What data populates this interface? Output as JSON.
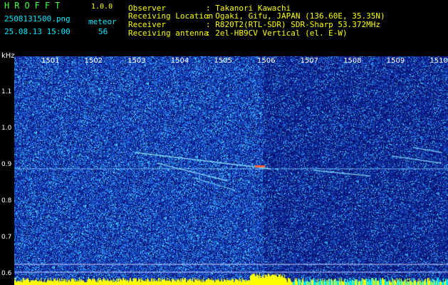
{
  "header": {
    "app_title": "HROFFT",
    "app_version": "1.0.0",
    "filename": "2508131500.png",
    "datetime": "25.08.13 15:00",
    "meteor_label": "meteor",
    "meteor_count": "56"
  },
  "info": {
    "observer_key": "Observer",
    "observer_val": ": Takanori Kawachi",
    "location_key": "Receiving Location",
    "location_val": ": Ogaki, Gifu, JAPAN (136.60E, 35.35N)",
    "receiver_key": "Receiver",
    "receiver_val": ": R820T2(RTL-SDR) SDR-Sharp 53.372MHz",
    "antenna_key": "Receiving antenna",
    "antenna_val": ": 2el-HB9CV Vertical (el. E-W)"
  },
  "chart_data": {
    "type": "heatmap",
    "ylabel": "kHz",
    "x_ticks": [
      "1501",
      "1502",
      "1503",
      "1504",
      "1505",
      "1506",
      "1507",
      "1508",
      "1509",
      "1510"
    ],
    "y_ticks": [
      "1.1",
      "1.0",
      "0.9",
      "0.8",
      "0.7",
      "0.6"
    ],
    "ylim": [
      0.57,
      1.2
    ],
    "carrier_khz": 0.89
  },
  "colors": {
    "background": "#0b1e8a",
    "meteor": "#ff6040",
    "info_text": "#ffff00",
    "title_text": "#3cff3c"
  }
}
